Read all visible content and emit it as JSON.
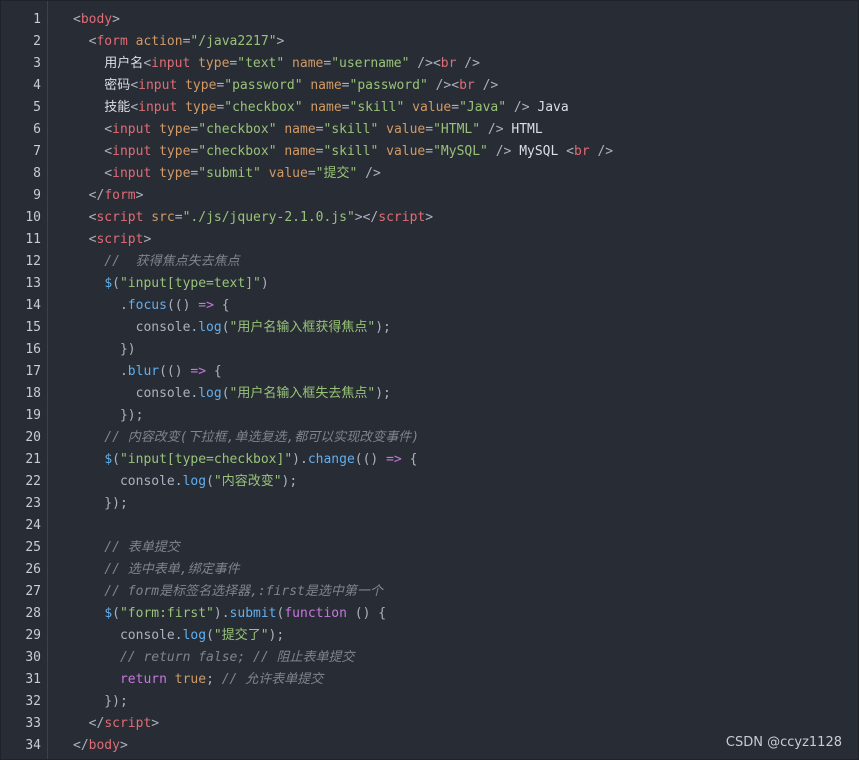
{
  "editor": {
    "line_numbers": [
      "1",
      "2",
      "3",
      "4",
      "5",
      "6",
      "7",
      "8",
      "9",
      "10",
      "11",
      "12",
      "13",
      "14",
      "15",
      "16",
      "17",
      "18",
      "19",
      "20",
      "21",
      "22",
      "23",
      "24",
      "25",
      "26",
      "27",
      "28",
      "29",
      "30",
      "31",
      "32",
      "33",
      "34"
    ],
    "lines": [
      [
        {
          "t": "punc",
          "v": "<"
        },
        {
          "t": "tag",
          "v": "body"
        },
        {
          "t": "punc",
          "v": ">"
        }
      ],
      [
        {
          "t": "punc",
          "v": "  <"
        },
        {
          "t": "tag",
          "v": "form"
        },
        {
          "t": "punc",
          "v": " "
        },
        {
          "t": "attr",
          "v": "action"
        },
        {
          "t": "punc",
          "v": "="
        },
        {
          "t": "str",
          "v": "\"/java2217\""
        },
        {
          "t": "punc",
          "v": ">"
        }
      ],
      [
        {
          "t": "text",
          "v": "    用户名"
        },
        {
          "t": "punc",
          "v": "<"
        },
        {
          "t": "tag",
          "v": "input"
        },
        {
          "t": "punc",
          "v": " "
        },
        {
          "t": "attr",
          "v": "type"
        },
        {
          "t": "punc",
          "v": "="
        },
        {
          "t": "str",
          "v": "\"text\""
        },
        {
          "t": "punc",
          "v": " "
        },
        {
          "t": "attr",
          "v": "name"
        },
        {
          "t": "punc",
          "v": "="
        },
        {
          "t": "str",
          "v": "\"username\""
        },
        {
          "t": "punc",
          "v": " /><"
        },
        {
          "t": "tag",
          "v": "br"
        },
        {
          "t": "punc",
          "v": " />"
        }
      ],
      [
        {
          "t": "text",
          "v": "    密码"
        },
        {
          "t": "punc",
          "v": "<"
        },
        {
          "t": "tag",
          "v": "input"
        },
        {
          "t": "punc",
          "v": " "
        },
        {
          "t": "attr",
          "v": "type"
        },
        {
          "t": "punc",
          "v": "="
        },
        {
          "t": "str",
          "v": "\"password\""
        },
        {
          "t": "punc",
          "v": " "
        },
        {
          "t": "attr",
          "v": "name"
        },
        {
          "t": "punc",
          "v": "="
        },
        {
          "t": "str",
          "v": "\"password\""
        },
        {
          "t": "punc",
          "v": " /><"
        },
        {
          "t": "tag",
          "v": "br"
        },
        {
          "t": "punc",
          "v": " />"
        }
      ],
      [
        {
          "t": "text",
          "v": "    技能"
        },
        {
          "t": "punc",
          "v": "<"
        },
        {
          "t": "tag",
          "v": "input"
        },
        {
          "t": "punc",
          "v": " "
        },
        {
          "t": "attr",
          "v": "type"
        },
        {
          "t": "punc",
          "v": "="
        },
        {
          "t": "str",
          "v": "\"checkbox\""
        },
        {
          "t": "punc",
          "v": " "
        },
        {
          "t": "attr",
          "v": "name"
        },
        {
          "t": "punc",
          "v": "="
        },
        {
          "t": "str",
          "v": "\"skill\""
        },
        {
          "t": "punc",
          "v": " "
        },
        {
          "t": "attr",
          "v": "value"
        },
        {
          "t": "punc",
          "v": "="
        },
        {
          "t": "str",
          "v": "\"Java\""
        },
        {
          "t": "punc",
          "v": " /> "
        },
        {
          "t": "text",
          "v": "Java"
        }
      ],
      [
        {
          "t": "punc",
          "v": "    <"
        },
        {
          "t": "tag",
          "v": "input"
        },
        {
          "t": "punc",
          "v": " "
        },
        {
          "t": "attr",
          "v": "type"
        },
        {
          "t": "punc",
          "v": "="
        },
        {
          "t": "str",
          "v": "\"checkbox\""
        },
        {
          "t": "punc",
          "v": " "
        },
        {
          "t": "attr",
          "v": "name"
        },
        {
          "t": "punc",
          "v": "="
        },
        {
          "t": "str",
          "v": "\"skill\""
        },
        {
          "t": "punc",
          "v": " "
        },
        {
          "t": "attr",
          "v": "value"
        },
        {
          "t": "punc",
          "v": "="
        },
        {
          "t": "str",
          "v": "\"HTML\""
        },
        {
          "t": "punc",
          "v": " /> "
        },
        {
          "t": "text",
          "v": "HTML"
        }
      ],
      [
        {
          "t": "punc",
          "v": "    <"
        },
        {
          "t": "tag",
          "v": "input"
        },
        {
          "t": "punc",
          "v": " "
        },
        {
          "t": "attr",
          "v": "type"
        },
        {
          "t": "punc",
          "v": "="
        },
        {
          "t": "str",
          "v": "\"checkbox\""
        },
        {
          "t": "punc",
          "v": " "
        },
        {
          "t": "attr",
          "v": "name"
        },
        {
          "t": "punc",
          "v": "="
        },
        {
          "t": "str",
          "v": "\"skill\""
        },
        {
          "t": "punc",
          "v": " "
        },
        {
          "t": "attr",
          "v": "value"
        },
        {
          "t": "punc",
          "v": "="
        },
        {
          "t": "str",
          "v": "\"MySQL\""
        },
        {
          "t": "punc",
          "v": " /> "
        },
        {
          "t": "text",
          "v": "MySQL "
        },
        {
          "t": "punc",
          "v": "<"
        },
        {
          "t": "tag",
          "v": "br"
        },
        {
          "t": "punc",
          "v": " />"
        }
      ],
      [
        {
          "t": "punc",
          "v": "    <"
        },
        {
          "t": "tag",
          "v": "input"
        },
        {
          "t": "punc",
          "v": " "
        },
        {
          "t": "attr",
          "v": "type"
        },
        {
          "t": "punc",
          "v": "="
        },
        {
          "t": "str",
          "v": "\"submit\""
        },
        {
          "t": "punc",
          "v": " "
        },
        {
          "t": "attr",
          "v": "value"
        },
        {
          "t": "punc",
          "v": "="
        },
        {
          "t": "str",
          "v": "\"提交\""
        },
        {
          "t": "punc",
          "v": " />"
        }
      ],
      [
        {
          "t": "punc",
          "v": "  </"
        },
        {
          "t": "tag",
          "v": "form"
        },
        {
          "t": "punc",
          "v": ">"
        }
      ],
      [
        {
          "t": "punc",
          "v": "  <"
        },
        {
          "t": "tag",
          "v": "script"
        },
        {
          "t": "punc",
          "v": " "
        },
        {
          "t": "attr",
          "v": "src"
        },
        {
          "t": "punc",
          "v": "="
        },
        {
          "t": "str",
          "v": "\"./js/jquery-2.1.0.js\""
        },
        {
          "t": "punc",
          "v": "></"
        },
        {
          "t": "tag",
          "v": "script"
        },
        {
          "t": "punc",
          "v": ">"
        }
      ],
      [
        {
          "t": "punc",
          "v": "  <"
        },
        {
          "t": "tag",
          "v": "script"
        },
        {
          "t": "punc",
          "v": ">"
        }
      ],
      [
        {
          "t": "cmt",
          "v": "    //  获得焦点失去焦点"
        }
      ],
      [
        {
          "t": "punc",
          "v": "    "
        },
        {
          "t": "dollar",
          "v": "$"
        },
        {
          "t": "punc",
          "v": "("
        },
        {
          "t": "str",
          "v": "\"input[type=text]\""
        },
        {
          "t": "punc",
          "v": ")"
        }
      ],
      [
        {
          "t": "punc",
          "v": "      ."
        },
        {
          "t": "fn",
          "v": "focus"
        },
        {
          "t": "punc",
          "v": "(() "
        },
        {
          "t": "kw",
          "v": "=>"
        },
        {
          "t": "punc",
          "v": " {"
        }
      ],
      [
        {
          "t": "punc",
          "v": "        console."
        },
        {
          "t": "fn",
          "v": "log"
        },
        {
          "t": "punc",
          "v": "("
        },
        {
          "t": "str",
          "v": "\"用户名输入框获得焦点\""
        },
        {
          "t": "punc",
          "v": ");"
        }
      ],
      [
        {
          "t": "punc",
          "v": "      })"
        }
      ],
      [
        {
          "t": "punc",
          "v": "      ."
        },
        {
          "t": "fn",
          "v": "blur"
        },
        {
          "t": "punc",
          "v": "(() "
        },
        {
          "t": "kw",
          "v": "=>"
        },
        {
          "t": "punc",
          "v": " {"
        }
      ],
      [
        {
          "t": "punc",
          "v": "        console."
        },
        {
          "t": "fn",
          "v": "log"
        },
        {
          "t": "punc",
          "v": "("
        },
        {
          "t": "str",
          "v": "\"用户名输入框失去焦点\""
        },
        {
          "t": "punc",
          "v": ");"
        }
      ],
      [
        {
          "t": "punc",
          "v": "      });"
        }
      ],
      [
        {
          "t": "cmt",
          "v": "    // 内容改变(下拉框,单选复选,都可以实现改变事件)"
        }
      ],
      [
        {
          "t": "punc",
          "v": "    "
        },
        {
          "t": "dollar",
          "v": "$"
        },
        {
          "t": "punc",
          "v": "("
        },
        {
          "t": "str",
          "v": "\"input[type=checkbox]\""
        },
        {
          "t": "punc",
          "v": ")."
        },
        {
          "t": "fn",
          "v": "change"
        },
        {
          "t": "punc",
          "v": "(() "
        },
        {
          "t": "kw",
          "v": "=>"
        },
        {
          "t": "punc",
          "v": " {"
        }
      ],
      [
        {
          "t": "punc",
          "v": "      console."
        },
        {
          "t": "fn",
          "v": "log"
        },
        {
          "t": "punc",
          "v": "("
        },
        {
          "t": "str",
          "v": "\"内容改变\""
        },
        {
          "t": "punc",
          "v": ");"
        }
      ],
      [
        {
          "t": "punc",
          "v": "    });"
        }
      ],
      [
        {
          "t": "punc",
          "v": ""
        }
      ],
      [
        {
          "t": "cmt",
          "v": "    // 表单提交"
        }
      ],
      [
        {
          "t": "cmt",
          "v": "    // 选中表单,绑定事件"
        }
      ],
      [
        {
          "t": "cmt",
          "v": "    // form是标签名选择器,:first是选中第一个"
        }
      ],
      [
        {
          "t": "punc",
          "v": "    "
        },
        {
          "t": "dollar",
          "v": "$"
        },
        {
          "t": "punc",
          "v": "("
        },
        {
          "t": "str",
          "v": "\"form:first\""
        },
        {
          "t": "punc",
          "v": ")."
        },
        {
          "t": "fn",
          "v": "submit"
        },
        {
          "t": "punc",
          "v": "("
        },
        {
          "t": "kw",
          "v": "function"
        },
        {
          "t": "punc",
          "v": " () {"
        }
      ],
      [
        {
          "t": "punc",
          "v": "      console."
        },
        {
          "t": "fn",
          "v": "log"
        },
        {
          "t": "punc",
          "v": "("
        },
        {
          "t": "str",
          "v": "\"提交了\""
        },
        {
          "t": "punc",
          "v": ");"
        }
      ],
      [
        {
          "t": "cmt",
          "v": "      // return false; // 阻止表单提交"
        }
      ],
      [
        {
          "t": "punc",
          "v": "      "
        },
        {
          "t": "kw",
          "v": "return"
        },
        {
          "t": "punc",
          "v": " "
        },
        {
          "t": "attr",
          "v": "true"
        },
        {
          "t": "punc",
          "v": "; "
        },
        {
          "t": "cmt",
          "v": "// 允许表单提交"
        }
      ],
      [
        {
          "t": "punc",
          "v": "    });"
        }
      ],
      [
        {
          "t": "punc",
          "v": "  </"
        },
        {
          "t": "tag",
          "v": "script"
        },
        {
          "t": "punc",
          "v": ">"
        }
      ],
      [
        {
          "t": "punc",
          "v": "</"
        },
        {
          "t": "tag",
          "v": "body"
        },
        {
          "t": "punc",
          "v": ">"
        }
      ]
    ]
  },
  "watermark": "CSDN @ccyz1128",
  "colors": {
    "background": "#282c34",
    "tag": "#e06c75",
    "attribute": "#d19a66",
    "string": "#98c379",
    "comment": "#7f848e",
    "keyword": "#c678dd",
    "function": "#61afef"
  }
}
